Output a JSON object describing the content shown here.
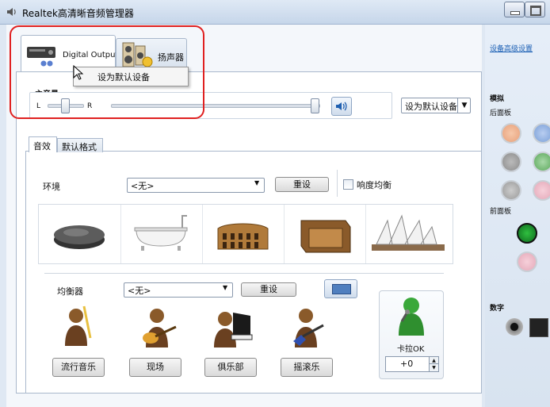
{
  "window": {
    "title": "Realtek高清晰音频管理器"
  },
  "device_tabs": [
    {
      "label": "Digital Output",
      "active": true
    },
    {
      "label": "扬声器",
      "active": false
    }
  ],
  "context_menu": {
    "item": "设为默认设备"
  },
  "volume": {
    "label": "主音量",
    "left_label": "L",
    "right_label": "R",
    "balance_level": 0.5,
    "volume_level": 1.0,
    "default_device_dropdown": "设为默认设备"
  },
  "effects_tabs": [
    "音效",
    "默认格式"
  ],
  "environment": {
    "label": "环境",
    "selected": "<无>",
    "reset_label": "重设",
    "loudness_label": "响度均衡",
    "loudness_checked": false,
    "presets": [
      "stone-icon",
      "bathtub-icon",
      "colosseum-icon",
      "wooden-box-icon",
      "opera-house-icon"
    ]
  },
  "equalizer": {
    "label": "均衡器",
    "selected": "<无>",
    "reset_label": "重设",
    "presets": [
      "流行音乐",
      "现场",
      "俱乐部",
      "摇滚乐"
    ]
  },
  "karaoke": {
    "label": "卡拉OK",
    "value": "+0"
  },
  "right_panel": {
    "advanced_link": "设备高级设置",
    "analog_label": "模拟",
    "back_panel_label": "后面板",
    "front_panel_label": "前面板",
    "digital_label": "数字"
  },
  "colors": {
    "highlight": "#e02020",
    "link": "#1a5fb4",
    "jack_orange": "#e8a07a",
    "jack_blue": "#7aa0d8",
    "jack_gray": "#8c8c8c",
    "jack_green": "#5aa85a",
    "jack_pink": "#e4a8b8",
    "jack_front_green": "#1e8a2e"
  }
}
